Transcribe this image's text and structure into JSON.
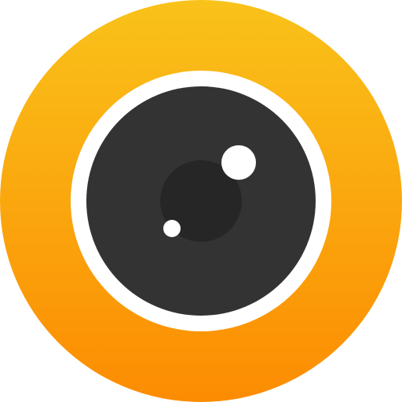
{
  "icon": {
    "name": "camera-lens-app-icon",
    "colors": {
      "outer_gradient_top": "#F9C21A",
      "outer_gradient_bottom": "#FC8C02",
      "ring": "#FFFFFF",
      "lens": "#333333",
      "pupil": "#262626",
      "highlight": "#FFFFFF"
    }
  }
}
